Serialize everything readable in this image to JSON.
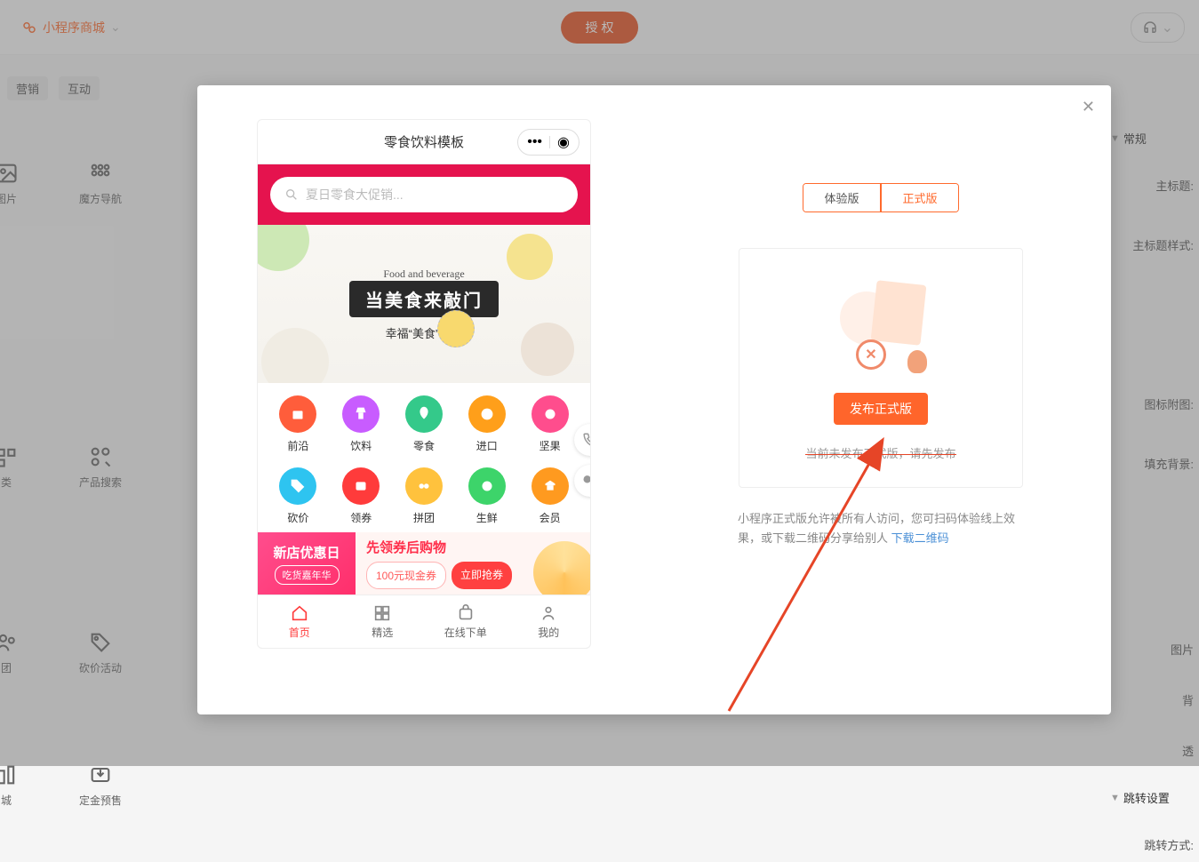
{
  "topbar": {
    "brand": "小程序商城",
    "auth": "授 权"
  },
  "left_nav": {
    "tabs": [
      "营销",
      "互动"
    ],
    "items": [
      {
        "icon": "image",
        "label": "图片"
      },
      {
        "icon": "grid",
        "label": "魔方导航"
      },
      {
        "icon": "cats",
        "label": "类"
      },
      {
        "icon": "search",
        "label": "产品搜索"
      },
      {
        "icon": "group",
        "label": "团"
      },
      {
        "icon": "tag",
        "label": "砍价活动"
      },
      {
        "icon": "city",
        "label": "城"
      },
      {
        "icon": "deposit",
        "label": "定金预售"
      }
    ]
  },
  "right_panel": {
    "groups": [
      "常规",
      "跳转设置"
    ],
    "rows": [
      "主标题:",
      "主标题样式:",
      "图标附图:",
      "填充背景:",
      "图片",
      "背",
      "透",
      "跳转方式:"
    ]
  },
  "modal": {
    "phone": {
      "title": "零食饮料模板",
      "search_placeholder": "夏日零食大促销...",
      "banner": {
        "script": "Food and beverage",
        "main": "当美食来敲门",
        "sub": "幸福“美食”每刻"
      },
      "categories": [
        {
          "label": "前沿",
          "color": "#ff5d3b"
        },
        {
          "label": "饮料",
          "color": "#c85cff"
        },
        {
          "label": "零食",
          "color": "#34c98a"
        },
        {
          "label": "进口",
          "color": "#ff9f1a"
        },
        {
          "label": "坚果",
          "color": "#ff4d8d"
        },
        {
          "label": "砍价",
          "color": "#2ec4f0"
        },
        {
          "label": "领券",
          "color": "#ff3b3b"
        },
        {
          "label": "拼团",
          "color": "#ffc23d"
        },
        {
          "label": "生鲜",
          "color": "#3dd46a"
        },
        {
          "label": "会员",
          "color": "#ff9a1f"
        }
      ],
      "coupon": {
        "left1": "新店优惠日",
        "left2": "吃货嘉年华",
        "title": "先领券后购物",
        "p1": "100元现金券",
        "p2": "立即抢券"
      },
      "tabs": [
        {
          "label": "首页",
          "active": true
        },
        {
          "label": "精选",
          "active": false
        },
        {
          "label": "在线下单",
          "active": false
        },
        {
          "label": "我的",
          "active": false
        }
      ]
    },
    "right": {
      "tabs": {
        "trial": "体验版",
        "release": "正式版"
      },
      "button": "发布正式版",
      "hint": "当前未发布正式版，请先发布",
      "desc_a": "小程序正式版允许被所有人访问，您可扫码体验线上效果，或下载二维码分享给别人",
      "link": "下载二维码"
    }
  }
}
